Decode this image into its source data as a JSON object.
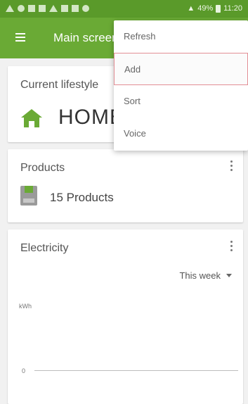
{
  "status_bar": {
    "time": "11:20",
    "battery": "49%"
  },
  "toolbar": {
    "title": "Main screen"
  },
  "lifestyle_card": {
    "title": "Current lifestyle",
    "value": "HOME"
  },
  "products_card": {
    "title": "Products",
    "count_text": "15 Products"
  },
  "electricity_card": {
    "title": "Electricity",
    "period": "This week",
    "y_unit": "kWh",
    "zero_label": "0"
  },
  "overflow_menu": {
    "items": [
      {
        "label": "Refresh"
      },
      {
        "label": "Add"
      },
      {
        "label": "Sort"
      },
      {
        "label": "Voice"
      }
    ]
  },
  "colors": {
    "toolbar": "#6aaa35",
    "status_bar": "#5a9a2a",
    "highlight_border": "#e28e95"
  }
}
